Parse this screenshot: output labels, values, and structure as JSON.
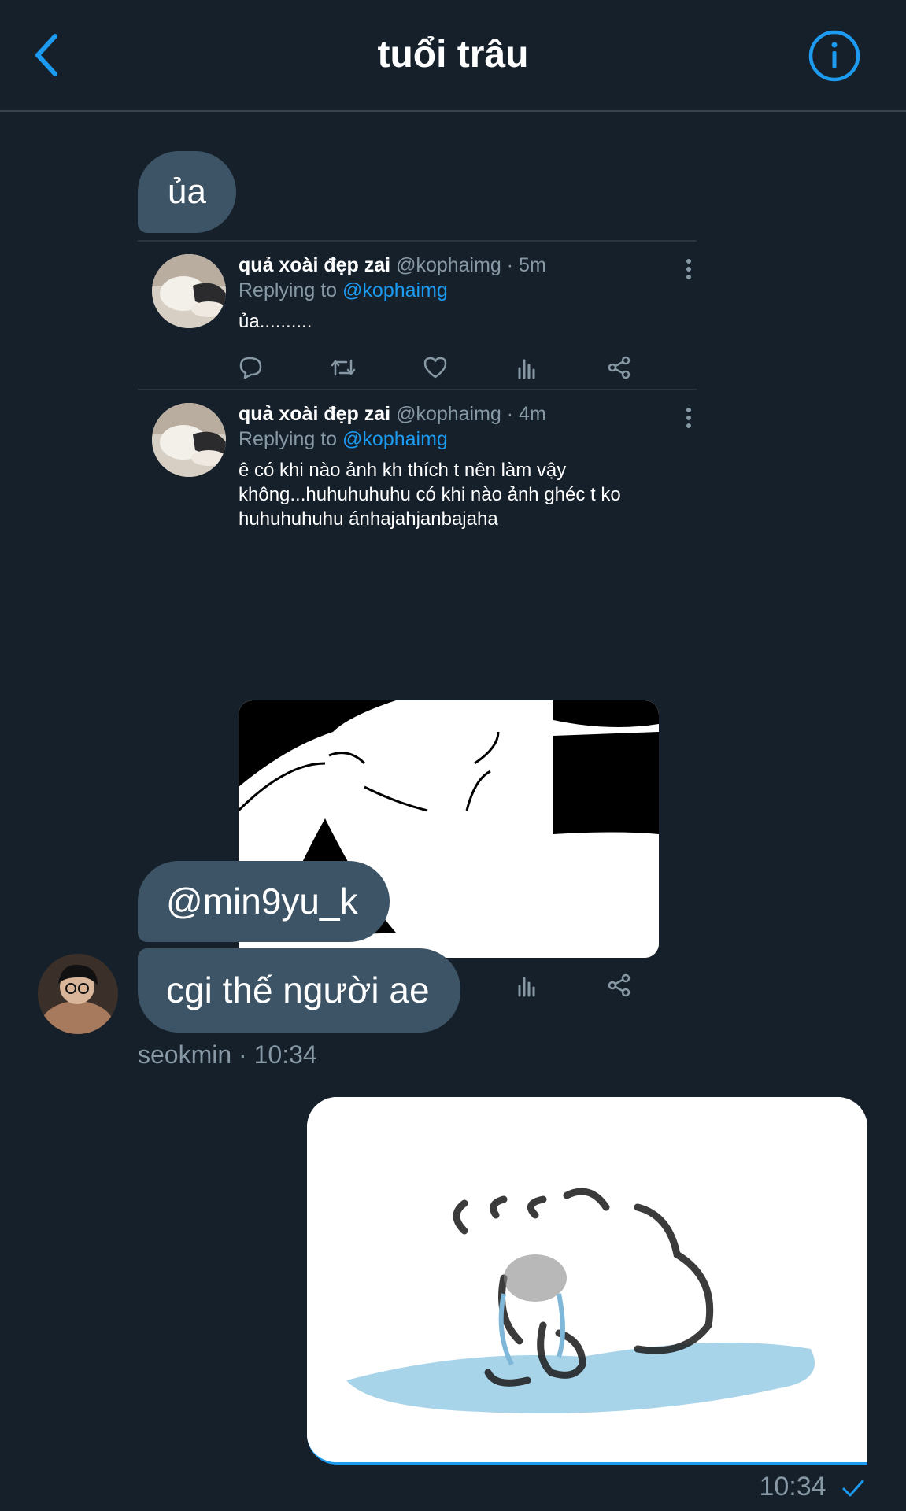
{
  "header": {
    "title": "tuổi trâu"
  },
  "messages": {
    "m1": "ủa",
    "m2": "@min9yu_k",
    "m3": "cgi thế người ae",
    "sender_meta": "seokmin · 10:34",
    "sent_meta": "10:34"
  },
  "tweets": [
    {
      "name": "quả xoài đẹp zai",
      "handle_time": "@kophaimg · 5m",
      "replying_prefix": "Replying to ",
      "replying_handle": "@kophaimg",
      "text": "ủa.........."
    },
    {
      "name": "quả xoài đẹp zai",
      "handle_time": "@kophaimg · 4m",
      "replying_prefix": "Replying to ",
      "replying_handle": "@kophaimg",
      "text_lines": [
        "ê có khi nào ảnh kh thích t nên làm vậy",
        "không...huhuhuhuhu có khi nào ảnh ghéc t ko",
        "huhuhuhuhu ánhajahjanbajaha"
      ]
    }
  ],
  "icons": [
    "back-chevron-icon",
    "info-icon",
    "reply-icon",
    "retweet-icon",
    "like-icon",
    "analytics-icon",
    "share-icon",
    "more-icon",
    "read-check-icon"
  ],
  "colors": {
    "background": "#15202b",
    "bubble": "#3d5466",
    "accent": "#1d9bf0",
    "muted": "#8899a6",
    "divider": "#38444d"
  }
}
